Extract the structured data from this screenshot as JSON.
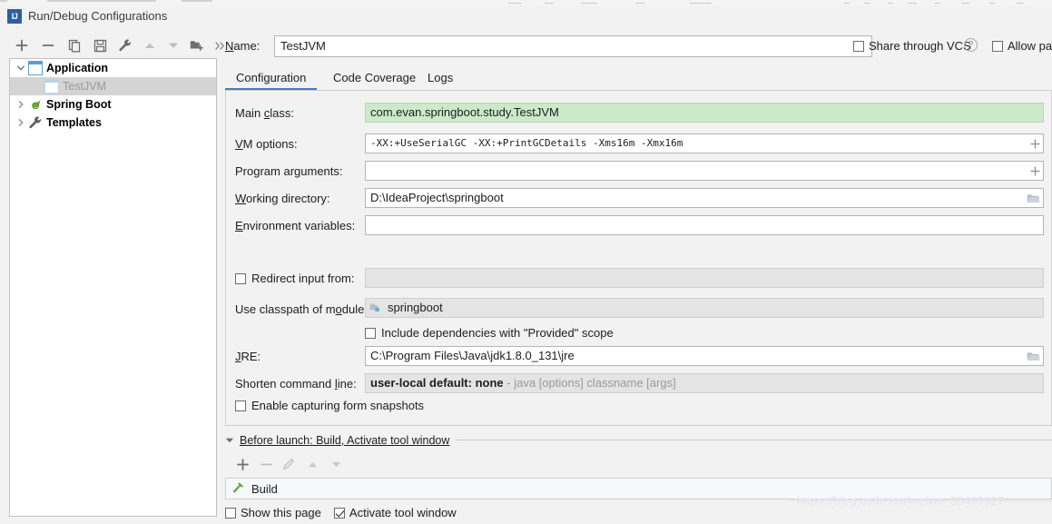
{
  "window": {
    "title": "Run/Debug Configurations",
    "app_icon": "intellij-idea-icon",
    "icon_text": "IJ"
  },
  "left_toolbar": {
    "buttons": [
      {
        "name": "add-configuration-button",
        "icon": "plus-icon",
        "label": "+"
      },
      {
        "name": "remove-configuration-button",
        "icon": "minus-icon",
        "label": "−"
      },
      {
        "name": "copy-configuration-button",
        "icon": "copy-icon",
        "label": "Copy"
      },
      {
        "name": "save-configuration-button",
        "icon": "save-icon",
        "label": "Save"
      },
      {
        "name": "edit-templates-button",
        "icon": "wrench-icon",
        "label": "Edit defaults"
      },
      {
        "name": "move-up-button",
        "icon": "arrow-up-icon",
        "label": "Move Up"
      },
      {
        "name": "move-down-button",
        "icon": "arrow-down-icon",
        "label": "Move Down"
      },
      {
        "name": "new-folder-button",
        "icon": "folder-add-icon",
        "label": "New Folder"
      },
      {
        "name": "more-options-button",
        "icon": "chevron-double-right-icon",
        "label": "»"
      }
    ]
  },
  "tree": {
    "nodes": [
      {
        "label": "Application",
        "icon": "application-icon",
        "expanded": true,
        "selected": false,
        "depth": 0
      },
      {
        "label": "TestJVM",
        "icon": "application-icon",
        "expanded": null,
        "selected": true,
        "depth": 1
      },
      {
        "label": "Spring Boot",
        "icon": "spring-boot-icon",
        "expanded": false,
        "selected": false,
        "depth": 0
      },
      {
        "label": "Templates",
        "icon": "wrench-icon",
        "expanded": false,
        "selected": false,
        "depth": 0
      }
    ]
  },
  "header": {
    "name_label": "Name:",
    "name_label_mnemonic": "N",
    "name_value": "TestJVM",
    "share_label": "Share through VCS",
    "share_checked": false,
    "help_icon": "question-mark-icon",
    "allow_label": "Allow para",
    "allow_checked": false
  },
  "tabs": [
    {
      "label": "Configuration",
      "active": true
    },
    {
      "label": "Code Coverage",
      "active": false
    },
    {
      "label": "Logs",
      "active": false
    }
  ],
  "configuration": {
    "main_class": {
      "label": "Main class:",
      "value": "com.evan.springboot.study.TestJVM"
    },
    "vm_options": {
      "label": "VM options:",
      "value": "-XX:+UseSerialGC  -XX:+PrintGCDetails  -Xms16m  -Xmx16m",
      "expand_icon": "plus-icon"
    },
    "program_arguments": {
      "label": "Program arguments:",
      "value": "",
      "expand_icon": "plus-icon"
    },
    "working_directory": {
      "label": "Working directory:",
      "value": "D:\\IdeaProject\\springboot",
      "browse_icon": "folder-icon"
    },
    "environment_variables": {
      "label": "Environment variables:",
      "value": ""
    },
    "redirect_input": {
      "label": "Redirect input from:",
      "checked": false,
      "value": ""
    },
    "classpath_module": {
      "label": "Use classpath of module:",
      "value": "springboot",
      "icon": "module-icon"
    },
    "include_provided": {
      "label": "Include dependencies with \"Provided\" scope",
      "checked": false
    },
    "jre": {
      "label": "JRE:",
      "value": "C:\\Program Files\\Java\\jdk1.8.0_131\\jre",
      "browse_icon": "folder-icon"
    },
    "shorten_command_line": {
      "label": "Shorten command line:",
      "value": "user-local default: none",
      "hint": "- java [options] classname [args]"
    },
    "form_snapshots": {
      "label": "Enable capturing form snapshots",
      "checked": false
    }
  },
  "before_launch": {
    "title": "Before launch: Build, Activate tool window",
    "twisty_icon": "triangle-down-icon",
    "toolbar": [
      {
        "name": "add-task-button",
        "icon": "plus-icon",
        "label": "+",
        "enabled": true
      },
      {
        "name": "remove-task-button",
        "icon": "minus-icon",
        "label": "−",
        "enabled": false
      },
      {
        "name": "edit-task-button",
        "icon": "pencil-icon",
        "label": "Edit",
        "enabled": false
      },
      {
        "name": "task-move-up-button",
        "icon": "arrow-up-icon",
        "label": "Up",
        "enabled": false
      },
      {
        "name": "task-move-down-button",
        "icon": "arrow-down-icon",
        "label": "Down",
        "enabled": false
      }
    ],
    "tasks": [
      {
        "label": "Build",
        "icon": "hammer-icon"
      }
    ],
    "show_this_page": {
      "label": "Show this page",
      "checked": false
    },
    "activate_tool_window": {
      "label": "Activate tool window",
      "checked": true
    }
  },
  "watermark": {
    "text": "https://blog.csdn.net/weixin_30409927"
  },
  "colors": {
    "accent": "#3d7fc1",
    "field_green": "#cceac9",
    "selection": "#d4d4d4",
    "panel_bg": "#f2f2f2",
    "title_icon": "#2b5f9e"
  }
}
